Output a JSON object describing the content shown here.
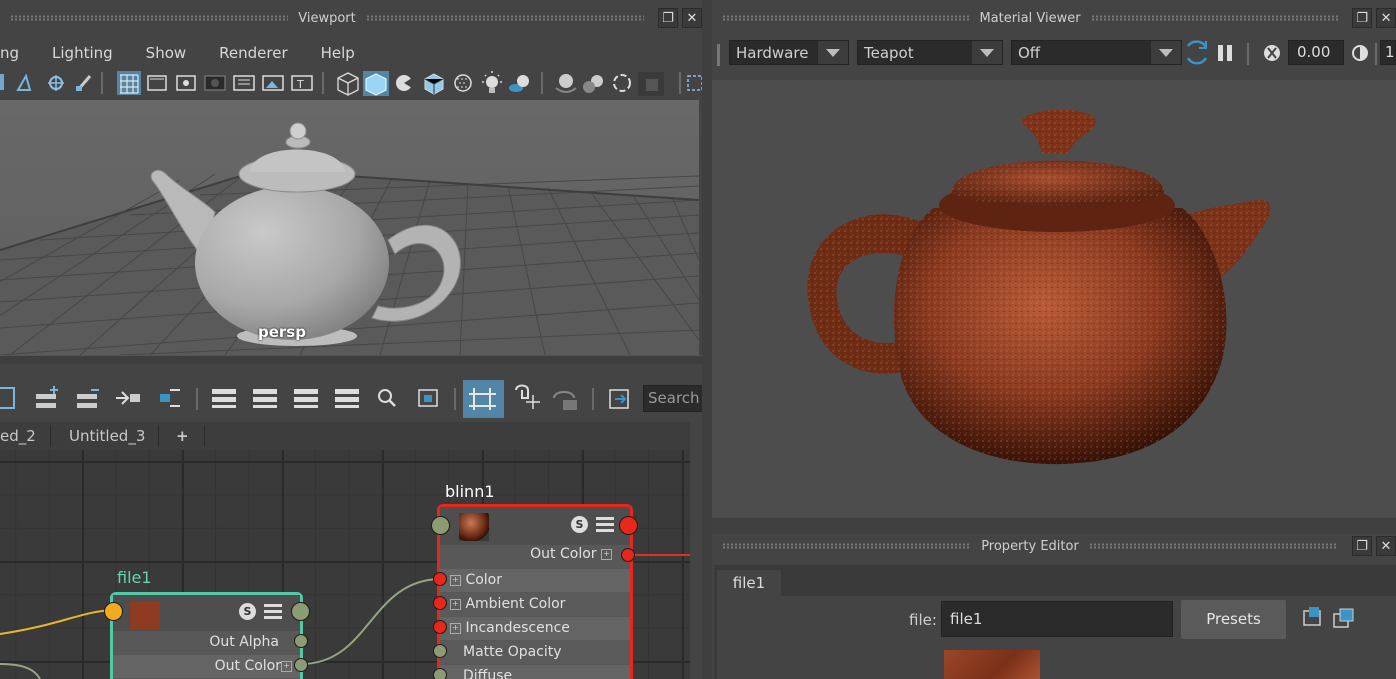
{
  "viewport": {
    "title": "Viewport",
    "menu": [
      "ng",
      "Lighting",
      "Show",
      "Renderer",
      "Help"
    ],
    "camera_label": "persp"
  },
  "material_viewer": {
    "title": "Material Viewer",
    "renderer": "Hardware",
    "geometry": "Teapot",
    "env": "Off",
    "exposure": "0.00",
    "gamma_partial": "1"
  },
  "node_editor": {
    "search_placeholder": "Search",
    "tabs": [
      "ed_2",
      "Untitled_3",
      "+"
    ],
    "nodes": {
      "blinn": {
        "name": "blinn1",
        "out": "Out Color",
        "attrs": [
          "Color",
          "Ambient Color",
          "Incandescence",
          "Matte Opacity",
          "Diffuse"
        ]
      },
      "file": {
        "name": "file1",
        "outs": [
          "Out Alpha",
          "Out Color"
        ]
      }
    }
  },
  "property_editor": {
    "title": "Property Editor",
    "tab": "file1",
    "file_label": "file:",
    "file_value": "file1",
    "presets": "Presets"
  },
  "colors": {
    "accent": "#5285a6",
    "selected_node": "#e8261a",
    "file_node": "#53c9a6"
  }
}
